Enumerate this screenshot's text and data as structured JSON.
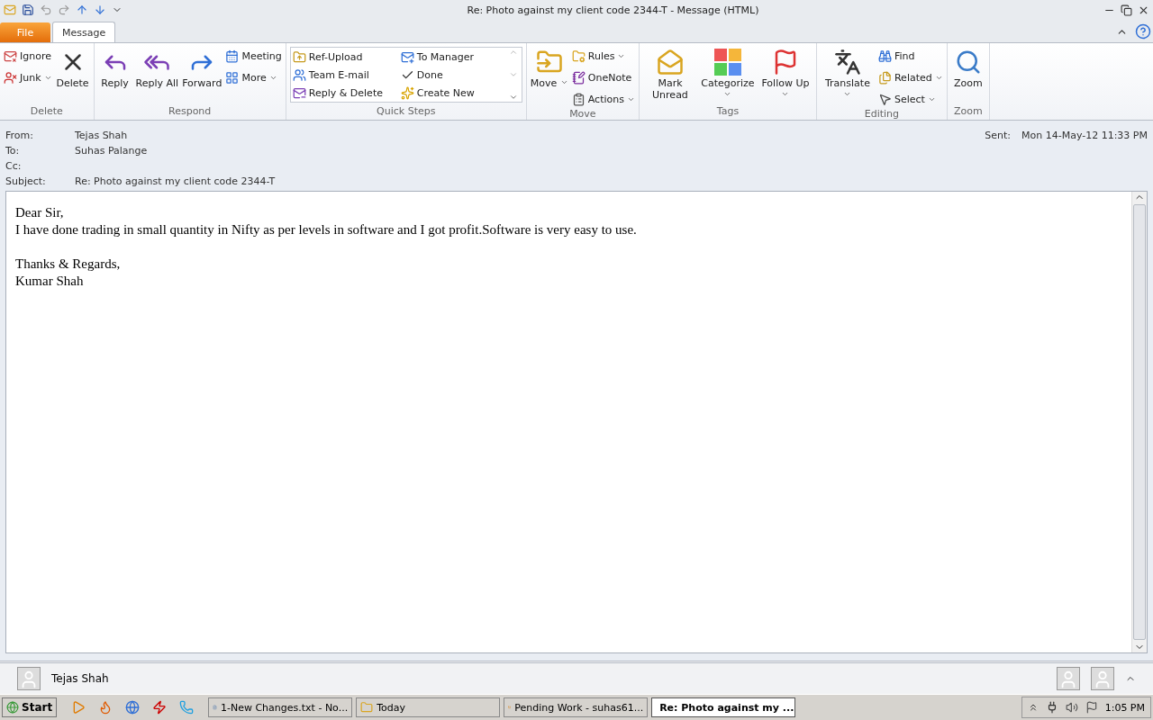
{
  "window": {
    "title": "Re: Photo against my client code 2344-T  -  Message (HTML)"
  },
  "ribbon_tabs": [
    {
      "label": "File",
      "kind": "file",
      "selected": false
    },
    {
      "label": "Message",
      "kind": "tab",
      "selected": true
    }
  ],
  "ribbon_groups": [
    {
      "label": "Delete",
      "columns": [
        {
          "kind": "stack",
          "items": [
            {
              "label": "Ignore",
              "dropdown": false
            },
            {
              "label": "Junk",
              "dropdown": true
            }
          ]
        },
        {
          "kind": "large",
          "label": "Delete",
          "dropdown": false
        }
      ]
    },
    {
      "label": "Respond",
      "columns": [
        {
          "kind": "large",
          "label": "Reply",
          "dropdown": false
        },
        {
          "kind": "large",
          "label": "Reply All",
          "dropdown": false
        },
        {
          "kind": "large",
          "label": "Forward",
          "dropdown": false
        },
        {
          "kind": "stack",
          "items": [
            {
              "label": "Meeting",
              "dropdown": false
            },
            {
              "label": "More",
              "dropdown": true
            }
          ]
        }
      ]
    },
    {
      "label": "Quick Steps",
      "columns": [
        {
          "kind": "gallery",
          "items": [
            {
              "label": "Ref-Upload"
            },
            {
              "label": "Team E-mail"
            },
            {
              "label": "Reply & Delete"
            },
            {
              "label": "To Manager"
            },
            {
              "label": "Done"
            },
            {
              "label": "Create New"
            }
          ]
        }
      ]
    },
    {
      "label": "Move",
      "columns": [
        {
          "kind": "large",
          "label": "Move",
          "dropdown": true
        },
        {
          "kind": "stack",
          "items": [
            {
              "label": "Rules",
              "dropdown": true
            },
            {
              "label": "OneNote",
              "dropdown": false
            },
            {
              "label": "Actions",
              "dropdown": true
            }
          ]
        }
      ]
    },
    {
      "label": "Tags",
      "columns": [
        {
          "kind": "large",
          "label": "Mark Unread",
          "dropdown": false
        },
        {
          "kind": "large",
          "label": "Categorize",
          "dropdown": true
        },
        {
          "kind": "large",
          "label": "Follow Up",
          "dropdown": true
        }
      ]
    },
    {
      "label": "Editing",
      "columns": [
        {
          "kind": "large",
          "label": "Translate",
          "dropdown": true
        },
        {
          "kind": "stack",
          "items": [
            {
              "label": "Find",
              "dropdown": false
            },
            {
              "label": "Related",
              "dropdown": true
            },
            {
              "label": "Select",
              "dropdown": true
            }
          ]
        }
      ]
    },
    {
      "label": "Zoom",
      "columns": [
        {
          "kind": "large",
          "label": "Zoom",
          "dropdown": false
        }
      ]
    }
  ],
  "header": {
    "fields": [
      {
        "label": "From:",
        "value": "Tejas Shah"
      },
      {
        "label": "To:",
        "value": "Suhas Palange"
      },
      {
        "label": "Cc:"
      },
      {
        "label": "Subject:",
        "value": "Re: Photo against my client code 2344-T"
      }
    ],
    "sent": {
      "label": "Sent:",
      "value": "Mon 14-May-12 11:33 PM"
    }
  },
  "body": {
    "paragraphs": [
      [
        "Dear Sir,",
        "I have done trading in small quantity in Nifty as per levels in software and I got profit.Software is very easy to use."
      ],
      [
        "Thanks & Regards,",
        "Kumar Shah"
      ]
    ]
  },
  "people_pane": {
    "name": "Tejas Shah"
  },
  "taskbar": {
    "start": "Start",
    "tasks": [
      {
        "label": "1-New Changes.txt - No...",
        "selected": false
      },
      {
        "label": "Today",
        "selected": false
      },
      {
        "label": "Pending Work - suhas61...",
        "selected": false
      },
      {
        "label": "Re: Photo against my ...",
        "selected": true
      }
    ],
    "clock": "1:05 PM"
  }
}
